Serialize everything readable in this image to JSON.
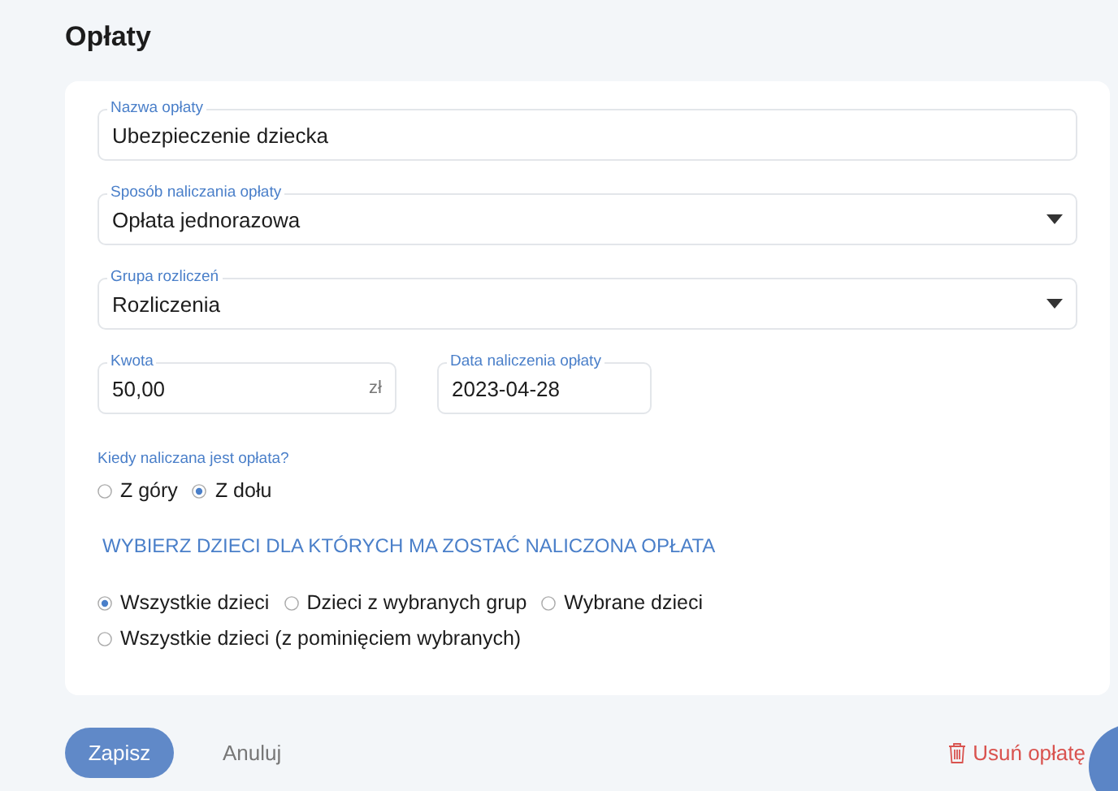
{
  "page": {
    "title": "Opłaty"
  },
  "fields": [
    {
      "kind": "text",
      "label": "Nazwa opłaty",
      "value": "Ubezpieczenie dziecka"
    },
    {
      "kind": "select",
      "label": "Sposób naliczania opłaty",
      "value": "Opłata jednorazowa"
    },
    {
      "kind": "select",
      "label": "Grupa rozliczeń",
      "value": "Rozliczenia"
    }
  ],
  "amount": {
    "label": "Kwota",
    "value": "50,00",
    "unit": "zł"
  },
  "date": {
    "label": "Data naliczenia opłaty",
    "value": "2023-04-28"
  },
  "timing": {
    "label": "Kiedy naliczana jest opłata?",
    "options": [
      {
        "label": "Z góry",
        "selected": false
      },
      {
        "label": "Z dołu",
        "selected": true
      }
    ]
  },
  "children_section": {
    "heading": "WYBIERZ DZIECI DLA KTÓRYCH MA ZOSTAĆ NALICZONA OPŁATA",
    "options": [
      {
        "label": "Wszystkie dzieci",
        "selected": true
      },
      {
        "label": "Dzieci z wybranych grup",
        "selected": false
      },
      {
        "label": "Wybrane dzieci",
        "selected": false
      },
      {
        "label": "Wszystkie dzieci (z pominięciem wybranych)",
        "selected": false
      }
    ]
  },
  "actions": {
    "save": "Zapisz",
    "cancel": "Anuluj",
    "delete": "Usuń opłatę"
  }
}
